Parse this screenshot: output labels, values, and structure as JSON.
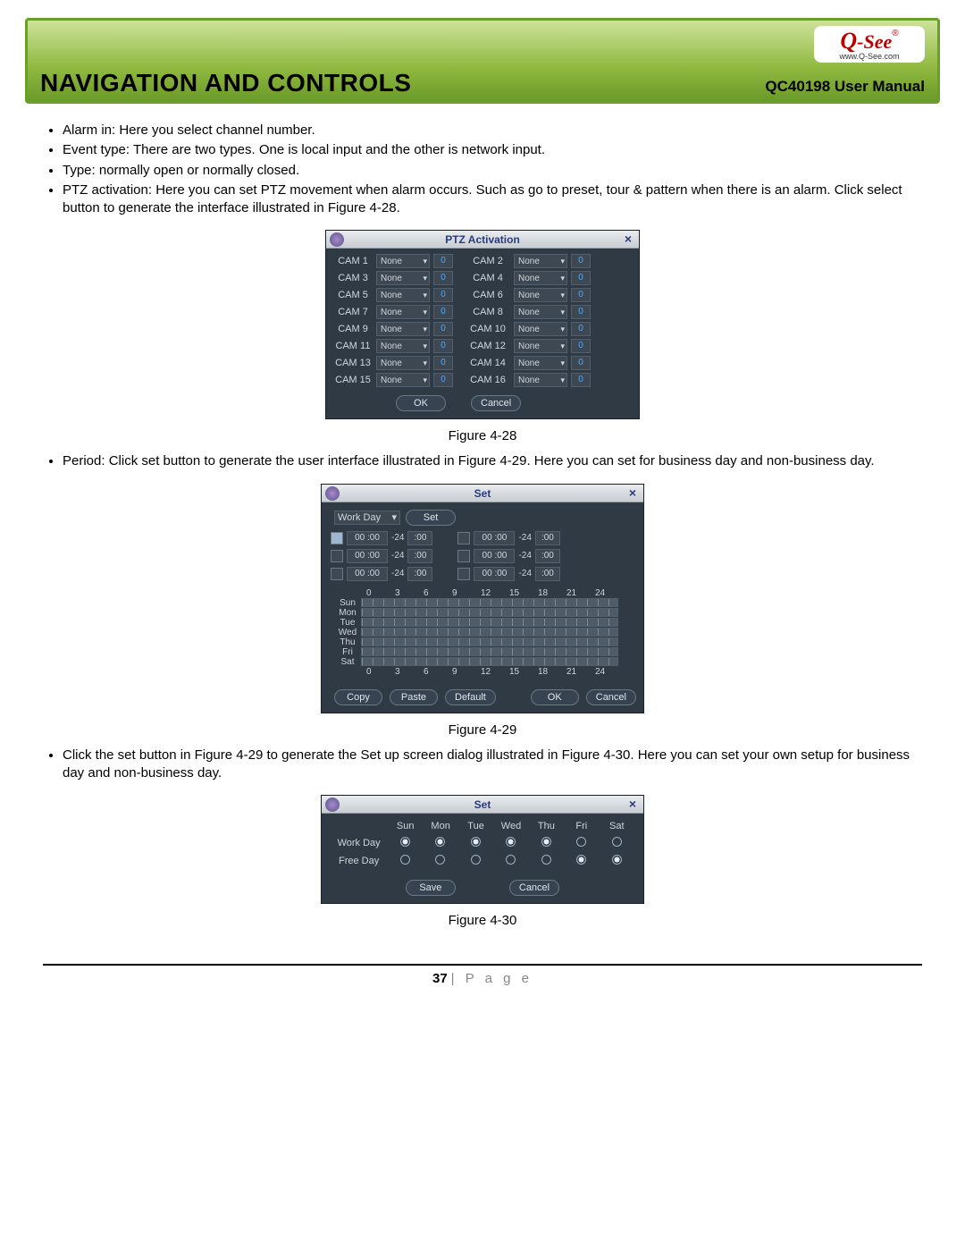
{
  "header": {
    "title": "NAVIGATION AND CONTROLS",
    "subtitle": "QC40198 User Manual",
    "logo_main": "Q-See",
    "logo_sub": "www.Q-See.com",
    "logo_r": "®"
  },
  "bullets_top": [
    "Alarm in: Here you select channel number.",
    "Event type: There are two types. One is local input and the other is network input.",
    "Type: normally open or normally closed.",
    "PTZ activation: Here you can set PTZ movement when alarm occurs. Such as go to preset, tour & pattern when there is an alarm. Click  select  button to generate the interface illustrated in Figure 4-28."
  ],
  "ptz": {
    "title": "PTZ Activation",
    "rows": [
      {
        "l": "CAM 1",
        "r": "CAM 2"
      },
      {
        "l": "CAM 3",
        "r": "CAM 4"
      },
      {
        "l": "CAM 5",
        "r": "CAM 6"
      },
      {
        "l": "CAM 7",
        "r": "CAM 8"
      },
      {
        "l": "CAM 9",
        "r": "CAM 10"
      },
      {
        "l": "CAM 11",
        "r": "CAM 12"
      },
      {
        "l": "CAM 13",
        "r": "CAM 14"
      },
      {
        "l": "CAM 15",
        "r": "CAM 16"
      }
    ],
    "sel_value": "None",
    "num_value": "0",
    "ok": "OK",
    "cancel": "Cancel",
    "caption": "Figure 4-28"
  },
  "bullet_period": "Period: Click set button to generate the user interface illustrated in Figure 4-29. Here you can set for business day and non-business day.",
  "set": {
    "title": "Set",
    "workday_sel": "Work Day",
    "set_btn": "Set",
    "time_from": "00 :00",
    "time_dash": "-24",
    "time_to": ":00",
    "ticks": [
      "0",
      "3",
      "6",
      "9",
      "12",
      "15",
      "18",
      "21",
      "24"
    ],
    "days": [
      "Sun",
      "Mon",
      "Tue",
      "Wed",
      "Thu",
      "Fri",
      "Sat"
    ],
    "btns": {
      "copy": "Copy",
      "paste": "Paste",
      "default": "Default",
      "ok": "OK",
      "cancel": "Cancel"
    },
    "caption": "Figure 4-29"
  },
  "bullet_setdays": "Click the set button in Figure 4-29 to generate the Set up screen dialog illustrated in Figure 4-30. Here you can set your own setup for business day and non-business day.",
  "daysdlg": {
    "title": "Set",
    "cols": [
      "Sun",
      "Mon",
      "Tue",
      "Wed",
      "Thu",
      "Fri",
      "Sat"
    ],
    "rows": [
      {
        "label": "Work Day",
        "on": [
          true,
          true,
          true,
          true,
          true,
          false,
          false
        ]
      },
      {
        "label": "Free Day",
        "on": [
          false,
          false,
          false,
          false,
          false,
          true,
          true
        ]
      }
    ],
    "save": "Save",
    "cancel": "Cancel",
    "caption": "Figure 4-30"
  },
  "footer": {
    "page": "37",
    "label": "P a g e"
  }
}
